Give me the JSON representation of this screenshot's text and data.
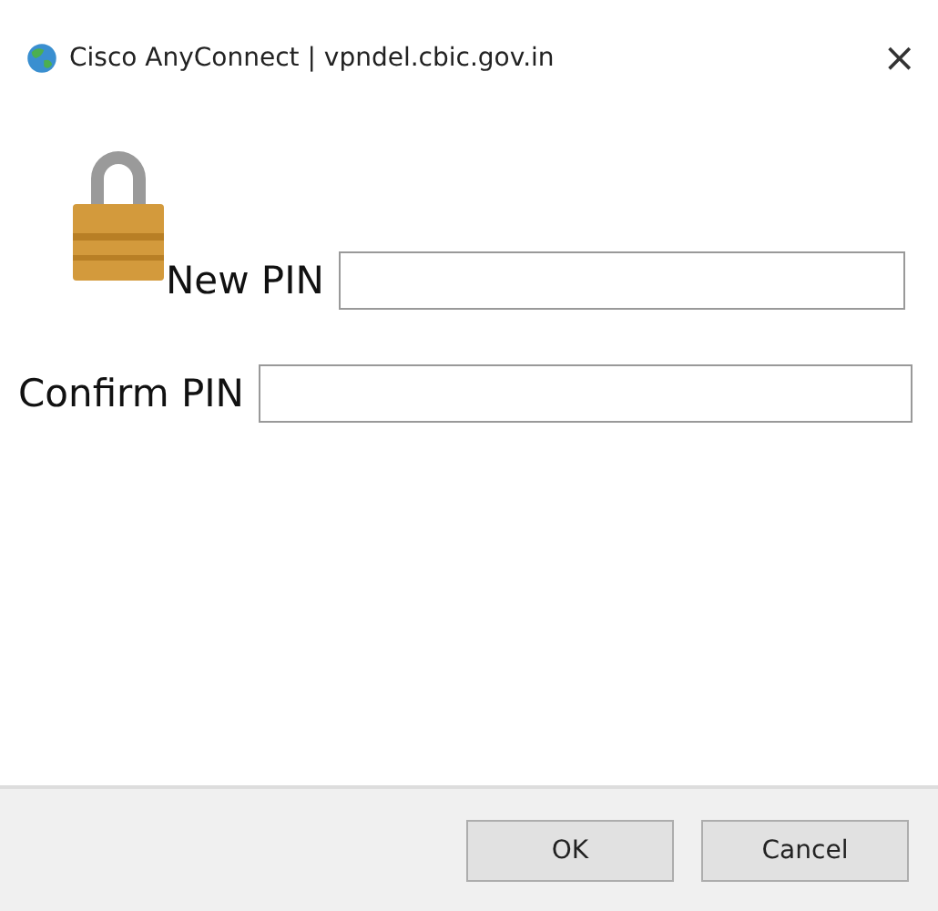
{
  "window": {
    "title": "Cisco AnyConnect | vpndel.cbic.gov.in",
    "close": "×"
  },
  "fields": [
    {
      "label": "New PIN"
    },
    {
      "label": "Confirm PIN"
    }
  ],
  "buttons": [
    "OK",
    "Cancel"
  ]
}
